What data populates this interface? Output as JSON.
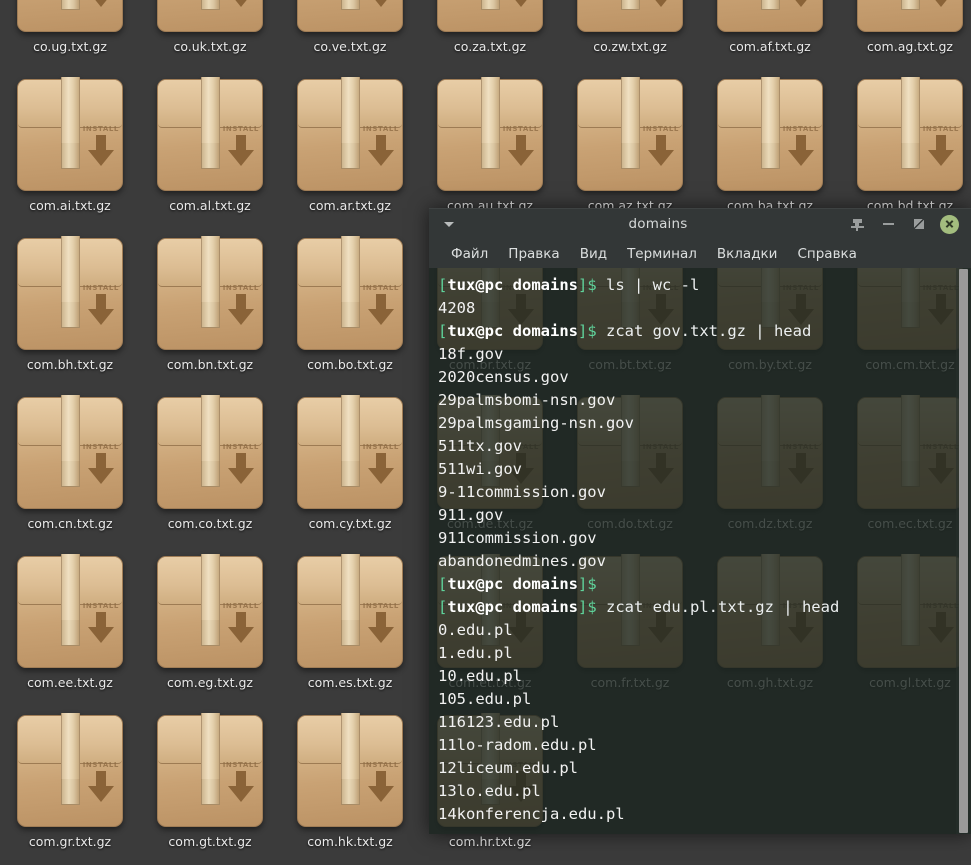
{
  "desktop": {
    "icon_name": "package-archive-icon",
    "icon_badge_text": "INSTALL",
    "background_color": "#3b3b3b",
    "files": [
      {
        "label": "co.ug.txt.gz"
      },
      {
        "label": "co.uk.txt.gz"
      },
      {
        "label": "co.ve.txt.gz"
      },
      {
        "label": "co.za.txt.gz"
      },
      {
        "label": "co.zw.txt.gz"
      },
      {
        "label": "com.af.txt.gz"
      },
      {
        "label": "com.ag.txt.gz"
      },
      {
        "label": "com.ai.txt.gz"
      },
      {
        "label": "com.al.txt.gz"
      },
      {
        "label": "com.ar.txt.gz"
      },
      {
        "label": "com.au.txt.gz"
      },
      {
        "label": "com.az.txt.gz"
      },
      {
        "label": "com.ba.txt.gz"
      },
      {
        "label": "com.bd.txt.gz"
      },
      {
        "label": "com.bh.txt.gz"
      },
      {
        "label": "com.bn.txt.gz"
      },
      {
        "label": "com.bo.txt.gz"
      },
      {
        "label": "com.br.txt.gz"
      },
      {
        "label": "com.bt.txt.gz"
      },
      {
        "label": "com.by.txt.gz"
      },
      {
        "label": "com.cm.txt.gz"
      },
      {
        "label": "com.cn.txt.gz"
      },
      {
        "label": "com.co.txt.gz"
      },
      {
        "label": "com.cy.txt.gz"
      },
      {
        "label": "com.de.txt.gz"
      },
      {
        "label": "com.do.txt.gz"
      },
      {
        "label": "com.dz.txt.gz"
      },
      {
        "label": "com.ec.txt.gz"
      },
      {
        "label": "com.ee.txt.gz"
      },
      {
        "label": "com.eg.txt.gz"
      },
      {
        "label": "com.es.txt.gz"
      },
      {
        "label": "com.et.txt.gz"
      },
      {
        "label": "com.fr.txt.gz"
      },
      {
        "label": "com.gh.txt.gz"
      },
      {
        "label": "com.gl.txt.gz"
      },
      {
        "label": "com.gr.txt.gz"
      },
      {
        "label": "com.gt.txt.gz"
      },
      {
        "label": "com.hk.txt.gz"
      },
      {
        "label": "com.hr.txt.gz"
      }
    ]
  },
  "terminal": {
    "title": "domains",
    "titlebar_buttons": {
      "menu": "window-menu-icon",
      "keep_above": "pin-icon",
      "minimize": "minimize-icon",
      "maximize": "maximize-icon",
      "close": "close-icon"
    },
    "close_button_color": "#a3bd7e",
    "menu": [
      {
        "label": "Файл"
      },
      {
        "label": "Правка"
      },
      {
        "label": "Вид"
      },
      {
        "label": "Терминал"
      },
      {
        "label": "Вкладки"
      },
      {
        "label": "Справка"
      }
    ],
    "prompt": {
      "open_bracket": "[",
      "user_host_dir": "tux@pc domains",
      "close_bracket": "]",
      "dollar": "$",
      "bracket_color": "#5fd39b"
    },
    "lines": [
      {
        "type": "prompt",
        "command": " ls | wc -l"
      },
      {
        "type": "output",
        "text": "4208"
      },
      {
        "type": "prompt",
        "command": " zcat gov.txt.gz | head"
      },
      {
        "type": "output",
        "text": "18f.gov"
      },
      {
        "type": "output",
        "text": "2020census.gov"
      },
      {
        "type": "output",
        "text": "29palmsbomi-nsn.gov"
      },
      {
        "type": "output",
        "text": "29palmsgaming-nsn.gov"
      },
      {
        "type": "output",
        "text": "511tx.gov"
      },
      {
        "type": "output",
        "text": "511wi.gov"
      },
      {
        "type": "output",
        "text": "9-11commission.gov"
      },
      {
        "type": "output",
        "text": "911.gov"
      },
      {
        "type": "output",
        "text": "911commission.gov"
      },
      {
        "type": "output",
        "text": "abandonedmines.gov"
      },
      {
        "type": "prompt",
        "command": ""
      },
      {
        "type": "prompt",
        "command": " zcat edu.pl.txt.gz | head"
      },
      {
        "type": "output",
        "text": "0.edu.pl"
      },
      {
        "type": "output",
        "text": "1.edu.pl"
      },
      {
        "type": "output",
        "text": "10.edu.pl"
      },
      {
        "type": "output",
        "text": "105.edu.pl"
      },
      {
        "type": "output",
        "text": "116123.edu.pl"
      },
      {
        "type": "output",
        "text": "11lo-radom.edu.pl"
      },
      {
        "type": "output",
        "text": "12liceum.edu.pl"
      },
      {
        "type": "output",
        "text": "13lo.edu.pl"
      },
      {
        "type": "output",
        "text": "14konferencja.edu.pl"
      }
    ]
  }
}
